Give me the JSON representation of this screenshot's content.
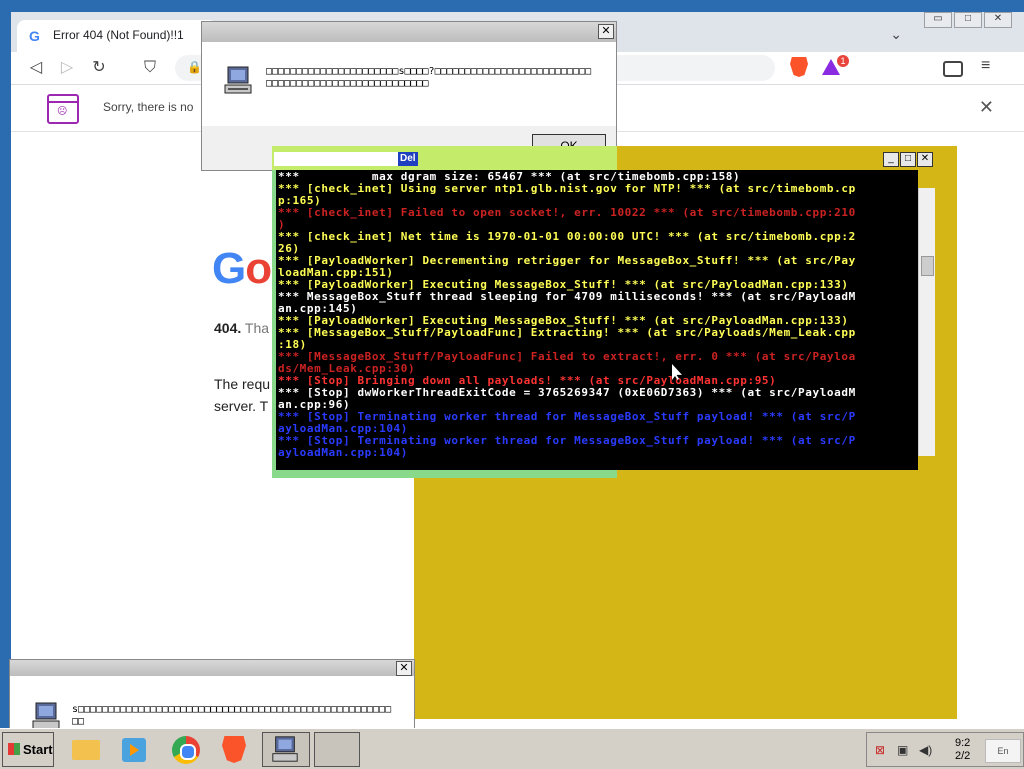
{
  "browser": {
    "tab_title": "Error 404 (Not Found)!!1",
    "tab_favicon": "G",
    "win_min": "▭",
    "win_max": "□",
    "win_close": "✕",
    "tab_dropdown": "⌄",
    "back_icon": "◁",
    "forward_icon": "▷",
    "reload_icon": "↻",
    "bookmark_icon": "⛉",
    "lock_icon": "🔒",
    "rewards_count": "1",
    "menu_icon": "≡"
  },
  "infobar": {
    "text": "Sorry, there is no",
    "close": "✕"
  },
  "page": {
    "logo_g": "G",
    "logo_o": "o",
    "error_code": "404.",
    "error_tail": "Tha",
    "req_text": "The requ",
    "srv_text": "server. T"
  },
  "msgbox_top": {
    "close": "✕",
    "text": "□□□□□□□□□□□□□□□□□□□□□□s□□□□?□□□□□□□□□□□□□□□□□□□□□□□□□□□□□□□□□□□□□□□□□□□□□□□□□□□□□",
    "ok_label": "OK"
  },
  "msgbox_bottom": {
    "close": "✕",
    "text": "s□□□□□□□□□□□□□□□□□□□□□□□□□□□□□□□□□□□□□□□□□□□□□□□□□□□□□□"
  },
  "yellow_window": {
    "selected_text": "Del",
    "min": "_",
    "max": "□",
    "close": "✕"
  },
  "console": {
    "lines": [
      {
        "text": "***          max dgram size: 65467 *** (at src/timebomb.cpp:158)",
        "color": "#ffffff"
      },
      {
        "text": "*** [check_inet] Using server ntp1.glb.nist.gov for NTP! *** (at src/timebomb.cp",
        "color": "#ffff55"
      },
      {
        "text": "p:165)",
        "color": "#ffff55"
      },
      {
        "text": "*** [check_inet] Failed to open socket!, err. 10022 *** (at src/timebomb.cpp:210",
        "color": "#cc2222"
      },
      {
        "text": ")",
        "color": "#cc2222"
      },
      {
        "text": "*** [check_inet] Net time is 1970-01-01 00:00:00 UTC! *** (at src/timebomb.cpp:2",
        "color": "#ffff55"
      },
      {
        "text": "26)",
        "color": "#ffff55"
      },
      {
        "text": "*** [PayloadWorker] Decrementing retrigger for MessageBox_Stuff! *** (at src/Pay",
        "color": "#ffff55"
      },
      {
        "text": "loadMan.cpp:151)",
        "color": "#ffff55"
      },
      {
        "text": "*** [PayloadWorker] Executing MessageBox_Stuff! *** (at src/PayloadMan.cpp:133)",
        "color": "#ffff55"
      },
      {
        "text": "*** MessageBox_Stuff thread sleeping for 4709 milliseconds! *** (at src/PayloadM",
        "color": "#ffffff"
      },
      {
        "text": "an.cpp:145)",
        "color": "#ffffff"
      },
      {
        "text": "*** [PayloadWorker] Executing MessageBox_Stuff! *** (at src/PayloadMan.cpp:133)",
        "color": "#ffff55"
      },
      {
        "text": "*** [MessageBox_Stuff/PayloadFunc] Extracting! *** (at src/Payloads/Mem_Leak.cpp",
        "color": "#ffff55"
      },
      {
        "text": ":18)",
        "color": "#ffff55"
      },
      {
        "text": "*** [MessageBox_Stuff/PayloadFunc] Failed to extract!, err. 0 *** (at src/Payloa",
        "color": "#cc2222"
      },
      {
        "text": "ds/Mem_Leak.cpp:30)",
        "color": "#cc2222"
      },
      {
        "text": "*** [Stop] Bringing down all payloads! *** (at src/PayloadMan.cpp:95)",
        "color": "#ff3333"
      },
      {
        "text": "*** [Stop] dwWorkerThreadExitCode = 3765269347 (0xE06D7363) *** (at src/PayloadM",
        "color": "#ffffff"
      },
      {
        "text": "an.cpp:96)",
        "color": "#ffffff"
      },
      {
        "text": "*** [Stop] Terminating worker thread for MessageBox_Stuff payload! *** (at src/P",
        "color": "#2a3bff"
      },
      {
        "text": "ayloadMan.cpp:104)",
        "color": "#2a3bff"
      },
      {
        "text": "*** [Stop] Terminating worker thread for MessageBox_Stuff payload! *** (at src/P",
        "color": "#2a3bff"
      },
      {
        "text": "ayloadMan.cpp:104)",
        "color": "#2a3bff"
      }
    ]
  },
  "taskbar": {
    "start_label": "Start",
    "time": "9:2",
    "date": "2/2",
    "lang": "En"
  },
  "icons": {
    "tray_network": "⊠",
    "tray_monitor": "▣",
    "tray_volume": "◀)"
  }
}
